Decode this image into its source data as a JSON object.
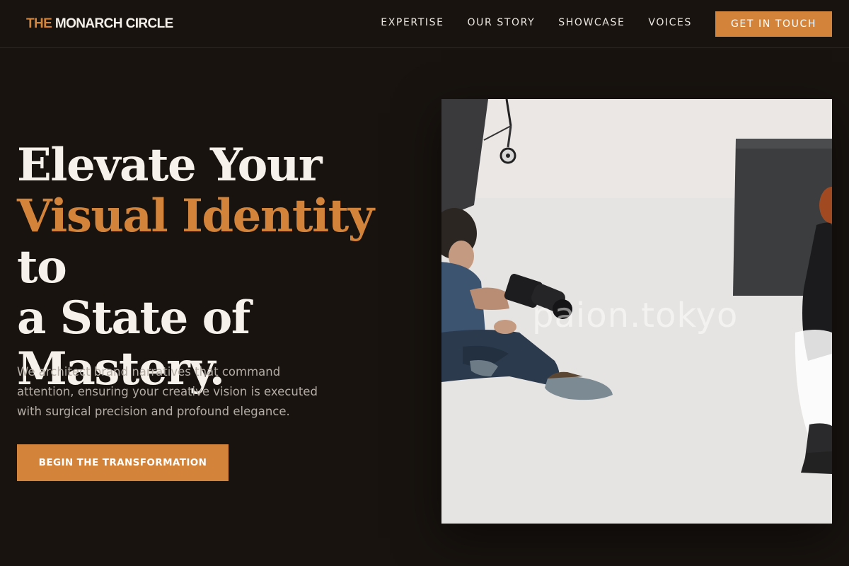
{
  "header": {
    "logo_prefix": "THE",
    "logo_suffix": "MONARCH CIRCLE",
    "nav": [
      "EXPERTISE",
      "OUR STORY",
      "SHOWCASE",
      "VOICES"
    ],
    "cta_label": "GET IN TOUCH"
  },
  "hero": {
    "title_line1": "Elevate Your",
    "title_accent": "Visual Identity",
    "title_after_accent": " to",
    "title_line3": "a State of",
    "title_line4": "Mastery.",
    "subtitle": "We architect brand narratives that command attention, ensuring your creative vision is executed with surgical precision and profound elegance.",
    "cta_label": "BEGIN THE TRANSFORMATION",
    "image_watermark": "paion.tokyo"
  },
  "colors": {
    "background": "#18130f",
    "accent": "#d4843a",
    "text": "#f6f1ea",
    "muted_text": "#b4ada5"
  }
}
